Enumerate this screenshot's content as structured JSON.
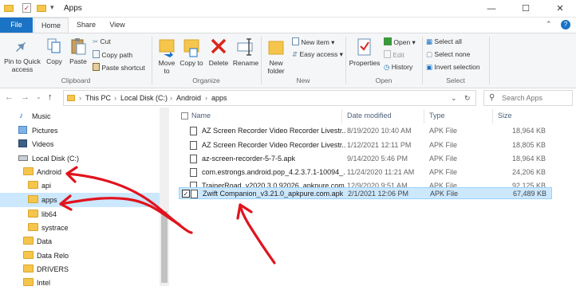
{
  "window": {
    "title": "Apps",
    "minimize": "—",
    "maximize": "☐",
    "close": "✕",
    "qat_dropdown": "▾"
  },
  "tabs": [
    "File",
    "Home",
    "Share",
    "View"
  ],
  "ribbon": {
    "clipboard": {
      "group": "Clipboard",
      "pin": "Pin to Quick access",
      "copy": "Copy",
      "paste": "Paste",
      "cut": "Cut",
      "copy_path": "Copy path",
      "paste_shortcut": "Paste shortcut"
    },
    "organize": {
      "group": "Organize",
      "move_to": "Move to",
      "copy_to": "Copy to",
      "delete": "Delete",
      "rename": "Rename"
    },
    "new": {
      "group": "New",
      "new_folder": "New folder",
      "new_item": "New item",
      "easy_access": "Easy access"
    },
    "open": {
      "group": "Open",
      "properties": "Properties",
      "open": "Open",
      "edit": "Edit",
      "history": "History"
    },
    "select": {
      "group": "Select",
      "select_all": "Select all",
      "select_none": "Select none",
      "invert": "Invert selection"
    }
  },
  "address": {
    "crumbs": [
      "This PC",
      "Local Disk (C:)",
      "Android",
      "apps"
    ],
    "search_placeholder": "Search Apps"
  },
  "nav": [
    {
      "label": "Music",
      "icon": "music-icon"
    },
    {
      "label": "Pictures",
      "icon": "pictures-icon"
    },
    {
      "label": "Videos",
      "icon": "videos-icon"
    },
    {
      "label": "Local Disk (C:)",
      "icon": "drive-icon"
    },
    {
      "label": "Android",
      "icon": "folder-icon"
    },
    {
      "label": "api",
      "icon": "folder-icon"
    },
    {
      "label": "apps",
      "icon": "folder-icon",
      "selected": true
    },
    {
      "label": "lib64",
      "icon": "folder-icon"
    },
    {
      "label": "systrace",
      "icon": "folder-icon"
    },
    {
      "label": "Data",
      "icon": "folder-icon"
    },
    {
      "label": "Data Relo",
      "icon": "folder-icon"
    },
    {
      "label": "DRIVERS",
      "icon": "folder-icon"
    },
    {
      "label": "Intel",
      "icon": "folder-icon"
    }
  ],
  "columns": {
    "name": "Name",
    "date": "Date modified",
    "type": "Type",
    "size": "Size"
  },
  "files": [
    {
      "name": "AZ Screen Recorder Video Recorder Livestr...",
      "date": "8/19/2020 10:40 AM",
      "type": "APK File",
      "size": "18,964 KB"
    },
    {
      "name": "AZ Screen Recorder Video Recorder Livestr...",
      "date": "1/12/2021 12:11 PM",
      "type": "APK File",
      "size": "18,805 KB"
    },
    {
      "name": "az-screen-recorder-5-7-5.apk",
      "date": "9/14/2020 5:46 PM",
      "type": "APK File",
      "size": "18,964 KB"
    },
    {
      "name": "com.estrongs.android.pop_4.2.3.7.1-10094_...",
      "date": "11/24/2020 11:21 AM",
      "type": "APK File",
      "size": "24,206 KB"
    },
    {
      "name": "TrainerRoad_v2020.3.0.92026_apkpure.com...",
      "date": "12/9/2020 9:51 AM",
      "type": "APK File",
      "size": "92,125 KB"
    },
    {
      "name": "Zwift Companion_v3.21.0_apkpure.com.apk",
      "date": "2/1/2021 12:06 PM",
      "type": "APK File",
      "size": "67,489 KB",
      "selected": true
    }
  ],
  "colors": {
    "file_tab": "#1a73c5",
    "selection": "#cce8ff",
    "annotation": "#e0141e"
  }
}
